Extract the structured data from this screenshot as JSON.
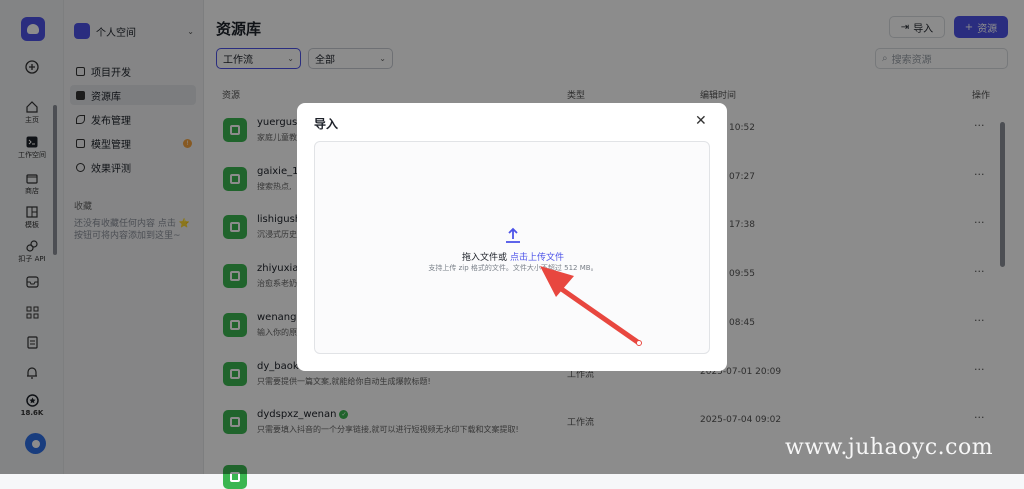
{
  "rail": {
    "items": [
      {
        "label": "主页"
      },
      {
        "label": "工作空间"
      },
      {
        "label": "商店"
      },
      {
        "label": "模板"
      },
      {
        "label": "扣子 API"
      }
    ],
    "count": "18.6K"
  },
  "sidebar": {
    "workspace": "个人空间",
    "nav": [
      {
        "label": "项目开发"
      },
      {
        "label": "资源库"
      },
      {
        "label": "发布管理"
      },
      {
        "label": "模型管理",
        "badge": "!"
      },
      {
        "label": "效果评测"
      }
    ],
    "favorites_title": "收藏",
    "favorites_empty": "还没有收藏任何内容 点击 ⭐ 按钮可将内容添加到这里~"
  },
  "main": {
    "title": "资源库",
    "import_label": "导入",
    "add_label": "资源",
    "filter_type": "工作流",
    "filter_scope": "全部",
    "search_placeholder": "搜索资源",
    "columns": {
      "resource": "资源",
      "type": "类型",
      "edited": "编辑时间",
      "actions": "操作"
    },
    "rows": [
      {
        "name": "yuergushi",
        "desc": "家庭儿童教",
        "type": "",
        "time": "07-18 10:52"
      },
      {
        "name": "gaixie_16",
        "desc": "搜索热点,",
        "type": "",
        "time": "07-13 07:27"
      },
      {
        "name": "lishigushi",
        "desc": "沉浸式历史",
        "type": "",
        "time": "07-10 17:38"
      },
      {
        "name": "zhiyuxiao",
        "desc": "治愈系老奶",
        "type": "",
        "time": "07-04 09:55"
      },
      {
        "name": "wenangai",
        "desc": "输入你的原",
        "type": "",
        "time": "07-04 08:45"
      },
      {
        "name": "dy_baoku",
        "desc": "只需要提供一篇文案,就能给你自动生成爆款标题!",
        "type": "工作流",
        "time": "2025-07-01 20:09"
      },
      {
        "name": "dydspxz_wenan",
        "desc": "只需要填入抖音的一个分享链接,就可以进行短视频无水印下载和文案提取!",
        "type": "工作流",
        "time": "2025-07-04 09:02"
      }
    ],
    "more": "···"
  },
  "modal": {
    "title": "导入",
    "drop_text": "拖入文件或",
    "upload_link": "点击上传文件",
    "hint": "支持上传 zip 格式的文件。文件大小不超过 512 MB。"
  },
  "watermark": "www.juhaoyc.com",
  "colors": {
    "accent": "#4d53e8",
    "resource_icon": "#3bb651",
    "arrow": "#e8473f"
  }
}
